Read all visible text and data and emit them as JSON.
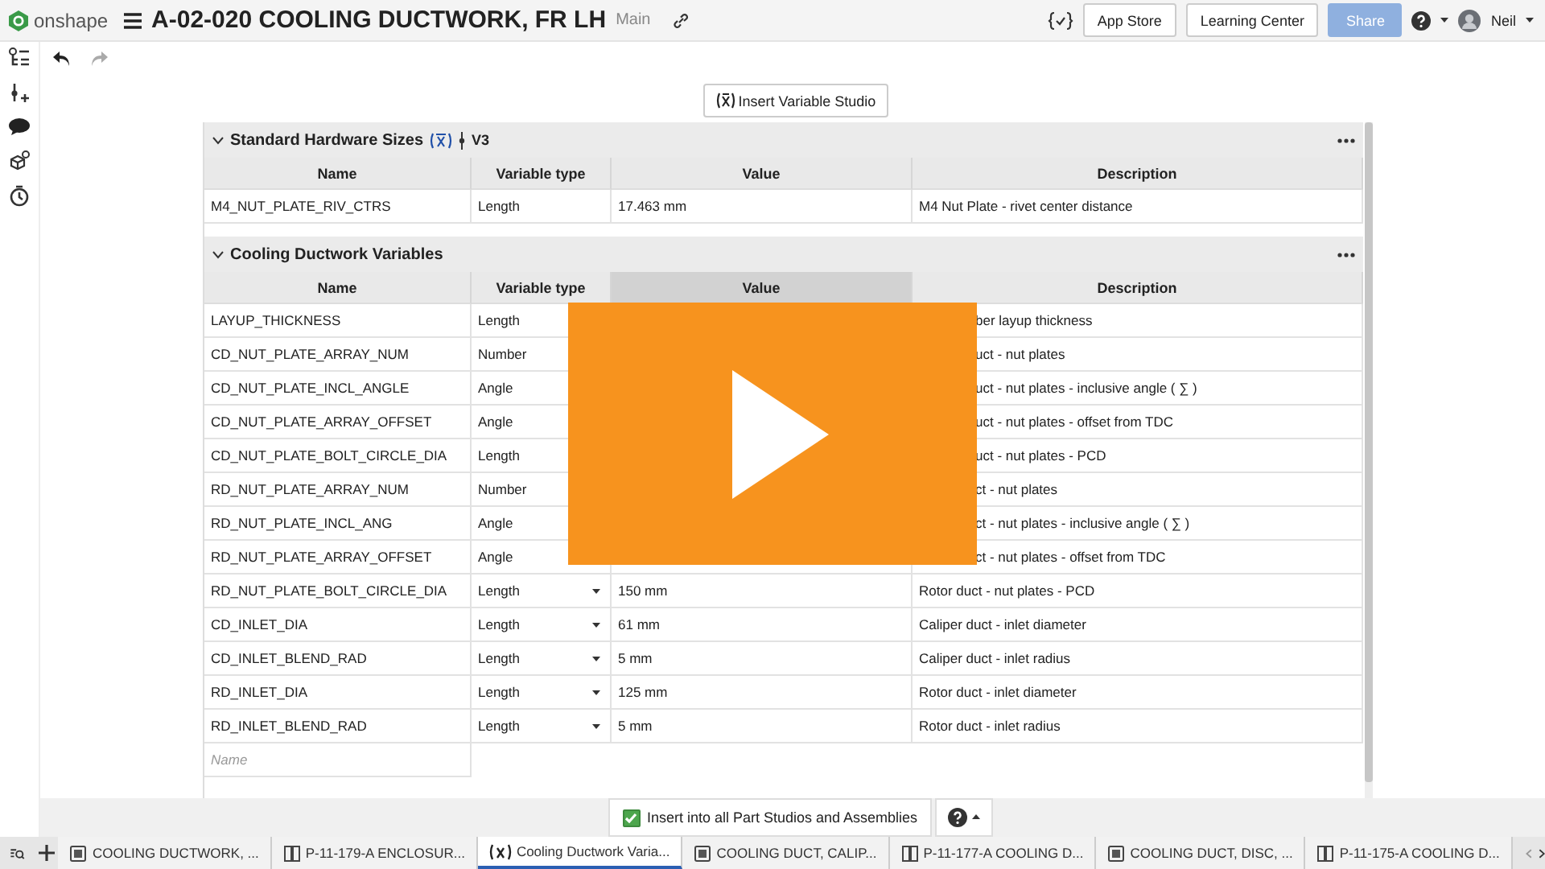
{
  "header": {
    "app_name": "onshape",
    "document_title": "A-02-020 COOLING DUCTWORK, FR LH",
    "branch": "Main",
    "buttons": [
      {
        "label": "App Store",
        "kind": "plain"
      },
      {
        "label": "Learning Center",
        "kind": "plain"
      },
      {
        "label": "Share",
        "kind": "primary"
      }
    ],
    "user": "Neil"
  },
  "insert_button": "Insert Variable Studio",
  "sections": [
    {
      "title": "Standard Hardware Sizes",
      "expanded": true,
      "version": "V3",
      "columns": [
        {
          "label": "Name",
          "highlighted": false
        },
        {
          "label": "Variable type",
          "highlighted": false
        },
        {
          "label": "Value",
          "highlighted": false
        },
        {
          "label": "Description",
          "highlighted": false
        }
      ],
      "rows": [
        {
          "name": "M4_NUT_PLATE_RIV_CTRS",
          "type": "Length",
          "value": "17.463 mm",
          "description": "M4 Nut Plate - rivet center distance"
        }
      ]
    },
    {
      "title": "Cooling Ductwork Variables",
      "expanded": true,
      "type_menus": true,
      "name_placeholder": "Name",
      "columns": [
        {
          "label": "Name",
          "highlighted": false
        },
        {
          "label": "Variable type",
          "highlighted": false
        },
        {
          "label": "Value",
          "highlighted": true
        },
        {
          "label": "Description",
          "highlighted": false
        }
      ],
      "rows": [
        {
          "name": "LAYUP_THICKNESS",
          "type": "Length",
          "description": "ber layup thickness"
        },
        {
          "name": "CD_NUT_PLATE_ARRAY_NUM",
          "type": "Number",
          "description": "uct - nut plates"
        },
        {
          "name": "CD_NUT_PLATE_INCL_ANGLE",
          "type": "Angle",
          "description": "uct - nut plates - inclusive angle ( ∑ )"
        },
        {
          "name": "CD_NUT_PLATE_ARRAY_OFFSET",
          "type": "Angle",
          "description": "uct - nut plates - offset from TDC"
        },
        {
          "name": "CD_NUT_PLATE_BOLT_CIRCLE_DIA",
          "type": "Length",
          "description": "uct - nut plates - PCD"
        },
        {
          "name": "RD_NUT_PLATE_ARRAY_NUM",
          "type": "Number",
          "description": "ct - nut plates"
        },
        {
          "name": "RD_NUT_PLATE_INCL_ANG",
          "type": "Angle",
          "description": "ct - nut plates - inclusive angle ( ∑ )"
        },
        {
          "name": "RD_NUT_PLATE_ARRAY_OFFSET",
          "type": "Angle",
          "description": "ct - nut plates - offset from TDC"
        },
        {
          "name": "RD_NUT_PLATE_BOLT_CIRCLE_DIA",
          "type": "Length",
          "value": "150 mm",
          "description": "Rotor duct - nut plates - PCD"
        },
        {
          "name": "CD_INLET_DIA",
          "type": "Length",
          "value": "61 mm",
          "description": "Caliper duct - inlet diameter"
        },
        {
          "name": "CD_INLET_BLEND_RAD",
          "type": "Length",
          "value": "5 mm",
          "description": "Caliper duct - inlet radius"
        },
        {
          "name": "RD_INLET_DIA",
          "type": "Length",
          "value": "125 mm",
          "description": "Rotor duct - inlet diameter"
        },
        {
          "name": "RD_INLET_BLEND_RAD",
          "type": "Length",
          "value": "5 mm",
          "description": "Rotor duct - inlet radius"
        }
      ]
    }
  ],
  "overlay": {
    "kind": "play-button"
  },
  "footer": {
    "insert_all": {
      "label": "Insert into all Part Studios and Assemblies",
      "checked": true
    }
  },
  "tabs": [
    {
      "label": "COOLING DUCTWORK, ...",
      "kind": "partstudio",
      "selected": false
    },
    {
      "label": "P-11-179-A ENCLOSUR...",
      "kind": "assembly",
      "selected": false
    },
    {
      "label": "Cooling Ductwork Varia...",
      "kind": "variables",
      "selected": true
    },
    {
      "label": "COOLING DUCT, CALIP...",
      "kind": "partstudio",
      "selected": false
    },
    {
      "label": "P-11-177-A COOLING D...",
      "kind": "assembly",
      "selected": false
    },
    {
      "label": "COOLING DUCT, DISC, ...",
      "kind": "partstudio",
      "selected": false
    },
    {
      "label": "P-11-175-A COOLING D...",
      "kind": "assembly",
      "selected": false
    }
  ]
}
